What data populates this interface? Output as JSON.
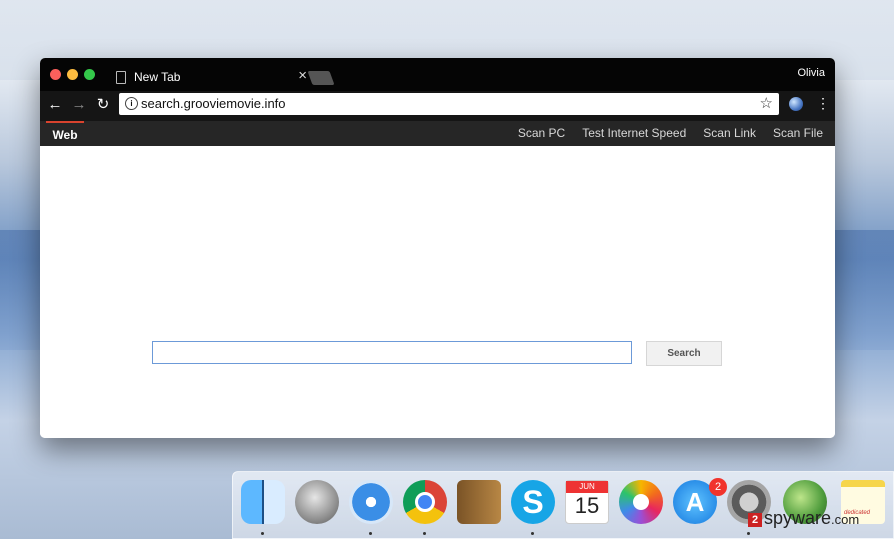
{
  "browser": {
    "tab": {
      "title": "New Tab",
      "close_glyph": "×"
    },
    "profile_name": "Olivia",
    "address_bar": {
      "url": "search.grooviemovie.info"
    },
    "icons": [
      "back-arrow-icon",
      "forward-arrow-icon",
      "reload-icon",
      "info-icon",
      "star-icon",
      "extension-globe-icon",
      "menu-dots-icon"
    ]
  },
  "site": {
    "nav": {
      "active": "Web",
      "links": [
        "Scan PC",
        "Test Internet Speed",
        "Scan Link",
        "Scan File"
      ]
    },
    "search": {
      "value": "",
      "button_label": "Search"
    }
  },
  "dock": {
    "apps": [
      "Finder",
      "Launchpad",
      "Safari",
      "Chrome",
      "Contacts",
      "Skype",
      "Calendar",
      "Photos",
      "App Store",
      "System Preferences",
      "Globe",
      "Notes"
    ],
    "calendar": {
      "month": "JUN",
      "day": "15"
    },
    "app_store_badge": "2",
    "skype_letter": "S",
    "app_store_letter": "A",
    "notes_text": "dedicated"
  },
  "watermark": {
    "mark": "2",
    "text": "spyware",
    "suffix": ".com"
  },
  "colors": {
    "accent": "#d9432e",
    "input_border": "#6c9ad8",
    "tab_bar": "#050505",
    "site_bar": "#262626"
  }
}
